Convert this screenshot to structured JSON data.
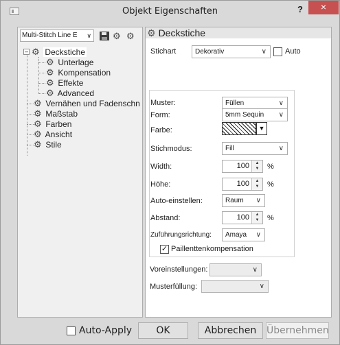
{
  "window": {
    "title": "Objekt Eigenschaften",
    "help_label": "?",
    "close_label": "×"
  },
  "left": {
    "set_select_value": "Multi-Stitch Line E",
    "tree": [
      {
        "label": "Deckstiche",
        "selected": true
      },
      {
        "label": "Unterlage"
      },
      {
        "label": "Kompensation"
      },
      {
        "label": "Effekte"
      },
      {
        "label": "Advanced"
      },
      {
        "label": "Vernähen und Fadenschn"
      },
      {
        "label": "Maßstab"
      },
      {
        "label": "Farben"
      },
      {
        "label": "Ansicht"
      },
      {
        "label": "Stile"
      }
    ]
  },
  "right": {
    "header": "Deckstiche",
    "stichart_label": "Stichart",
    "stichart_value": "Dekorativ",
    "auto_label": "Auto",
    "muster_label": "Muster:",
    "muster_value": "Füllen",
    "form_label": "Form:",
    "form_value": "5mm Sequin",
    "farbe_label": "Farbe:",
    "stichmodus_label": "Stichmodus:",
    "stichmodus_value": "Fill",
    "width_label": "Width:",
    "width_value": "100",
    "hoehe_label": "Höhe:",
    "hoehe_value": "100",
    "percent": "%",
    "auto_einstellen_label": "Auto-einstellen:",
    "auto_einstellen_value": "Raum",
    "abstand_label": "Abstand:",
    "abstand_value": "100",
    "zufuehrung_label": "Zuführungsrichtung:",
    "zufuehrung_value": "Amaya",
    "paillette_label": "Paillenttenkompensation",
    "voreinstellungen_label": "Voreinstellungen:",
    "voreinstellungen_value": "",
    "musterfuellung_label": "Musterfüllung:",
    "musterfuellung_value": ""
  },
  "footer": {
    "auto_apply_label": "Auto-Apply",
    "ok_label": "OK",
    "abbrechen_label": "Abbrechen",
    "uebernehmen_label": "Übernehmen"
  },
  "colors": {
    "close_button": "#c75050",
    "window_bg": "#d9d9d9"
  }
}
